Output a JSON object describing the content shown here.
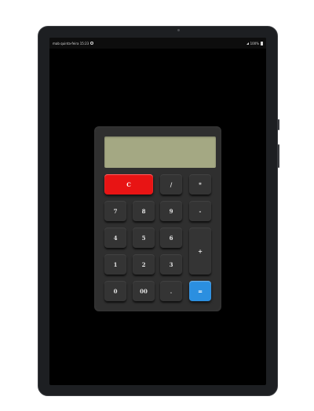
{
  "status_bar": {
    "left_text": "mab quinta-feira 15:23",
    "right_text": "100%",
    "icons": [
      "info-icon",
      "signal-icon",
      "battery-icon"
    ]
  },
  "calculator": {
    "display_value": "",
    "keys": {
      "clear": "C",
      "divide": "/",
      "multiply": "*",
      "seven": "7",
      "eight": "8",
      "nine": "9",
      "subtract": "-",
      "four": "4",
      "five": "5",
      "six": "6",
      "add": "+",
      "one": "1",
      "two": "2",
      "three": "3",
      "zero": "0",
      "double_zero": "00",
      "decimal": ".",
      "equals": "="
    }
  },
  "colors": {
    "display": "#a4a883",
    "clear_key": "#e81414",
    "equals_key": "#2b8fe0",
    "key": "#343434",
    "calculator_body": "#2f2f2f"
  }
}
